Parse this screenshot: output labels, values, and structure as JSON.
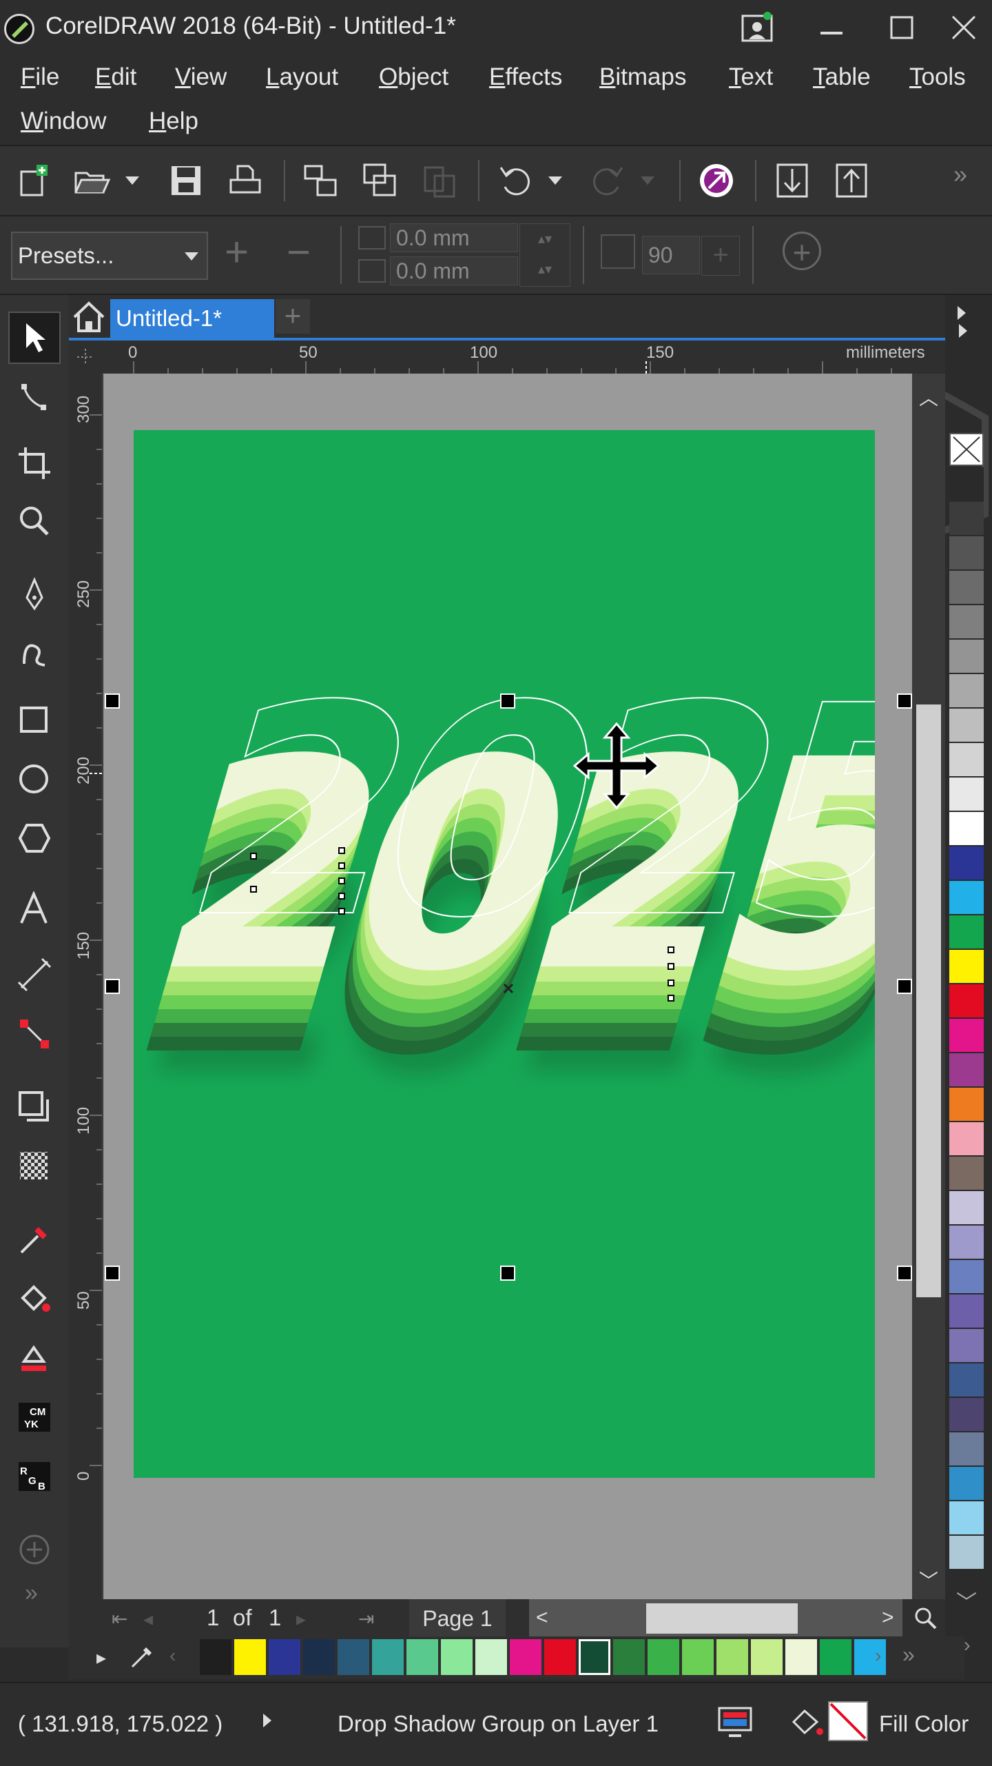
{
  "window": {
    "title": "CorelDRAW 2018 (64-Bit) - Untitled-1*"
  },
  "menu": {
    "items": [
      "File",
      "Edit",
      "View",
      "Layout",
      "Object",
      "Effects",
      "Bitmaps",
      "Text",
      "Table",
      "Tools",
      "Window",
      "Help"
    ]
  },
  "property_bar": {
    "presets_label": "Presets...",
    "x_field": "0.0 mm",
    "y_field": "0.0 mm",
    "angle_field": "90"
  },
  "document": {
    "tab_label": "Untitled-1*"
  },
  "ruler": {
    "horizontal_ticks": [
      "0",
      "50",
      "100",
      "150"
    ],
    "unit": "millimeters",
    "vertical_ticks": [
      "300",
      "250",
      "200",
      "150",
      "100",
      "50",
      "0"
    ]
  },
  "artwork": {
    "text": "2025",
    "background_color": "#17a856",
    "layer_colors": [
      "#eef5d8",
      "#c7ee8d",
      "#9ee06a",
      "#6ccf55",
      "#43b04a",
      "#2a7f3c"
    ]
  },
  "navigation": {
    "page_index": "1",
    "page_of": "of",
    "page_total": "1",
    "page_tab": "Page 1"
  },
  "palette": {
    "right_swatches": [
      "#2a2a2a",
      "#3c3c3c",
      "#555",
      "#6b6b6b",
      "#7f7f7f",
      "#949494",
      "#a9a9a9",
      "#bebebe",
      "#d3d3d3",
      "#e8e8e8",
      "#ffffff",
      "#2b3595",
      "#21b0e8",
      "#14a64e",
      "#fff100",
      "#e30b21",
      "#e4148a",
      "#9c3a8f",
      "#ef7b21",
      "#f2a3b4",
      "#7a6a61",
      "#c7c3dd",
      "#9e9acb",
      "#6a7fc0",
      "#6d5fa9",
      "#7d73b3",
      "#3b5b91",
      "#4e4470",
      "#6a7c9a",
      "#2e8fc9",
      "#8fd3f0",
      "#adc8d6"
    ],
    "bottom_swatches": [
      "#1f1f1f",
      "#fff200",
      "#2b3595",
      "#1b2f4a",
      "#295a7a",
      "#34a39a",
      "#5ac98d",
      "#8be89a",
      "#ccf3cc",
      "#e4148a",
      "#e30b21",
      "#144d36",
      "#2a7f3c",
      "#3bb14a",
      "#6ccf55",
      "#9ee06a",
      "#c7ee8d",
      "#eef5d8",
      "#14a64e",
      "#21b0e8"
    ]
  },
  "status": {
    "coordinates": "( 131.918, 175.022 )",
    "object_info": "Drop Shadow Group on Layer 1",
    "fill_label": "Fill Color"
  },
  "colors": {
    "accent": "#2f7fd8",
    "ui_bg": "#2b2b2b"
  }
}
